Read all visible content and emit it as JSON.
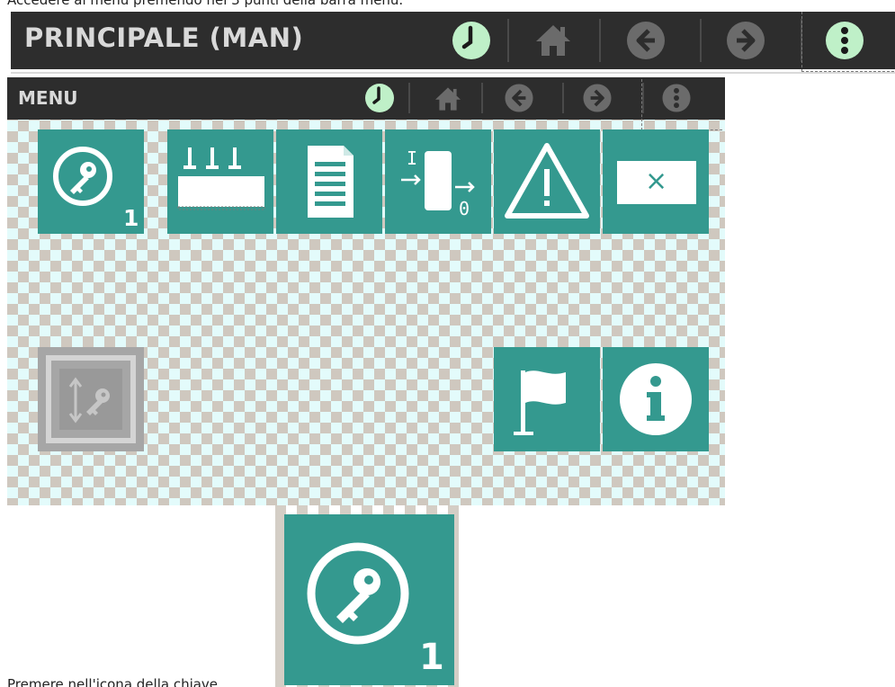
{
  "captions": {
    "top": "Accedere al menu premendo nei 3 punti della barra menu.",
    "bottom": "Premere nell'icona della chiave"
  },
  "top_bar": {
    "title": "PRINCIPALE (MAN)",
    "icons": [
      "clock-icon",
      "home-icon",
      "back-arrow-icon",
      "forward-arrow-icon",
      "more-vertical-icon"
    ]
  },
  "menu_screen": {
    "title": "MENU",
    "icons": [
      "clock-icon",
      "home-icon",
      "back-arrow-icon",
      "forward-arrow-icon",
      "more-vertical-icon"
    ],
    "tiles": [
      {
        "icon": "key-login-icon",
        "badge": "1"
      },
      {
        "icon": "machine-setup-icon"
      },
      {
        "icon": "document-icon"
      },
      {
        "icon": "io-module-icon",
        "label_in": "I",
        "label_out": "0"
      },
      {
        "icon": "warning-icon"
      },
      {
        "icon": "close-window-icon",
        "label": "×"
      },
      {
        "icon": "key-transfer-icon",
        "state": "disabled"
      },
      {
        "icon": "flag-icon"
      },
      {
        "icon": "info-icon"
      }
    ]
  },
  "zoom_tile": {
    "icon": "key-login-icon",
    "badge": "1"
  },
  "colors": {
    "bar_bg": "#2d2d2d",
    "tile_teal": "#34998f",
    "clock_green": "#bff0c8",
    "disabled_grey": "#a6a6a6",
    "nav_icon_grey": "#6b6b6b"
  }
}
